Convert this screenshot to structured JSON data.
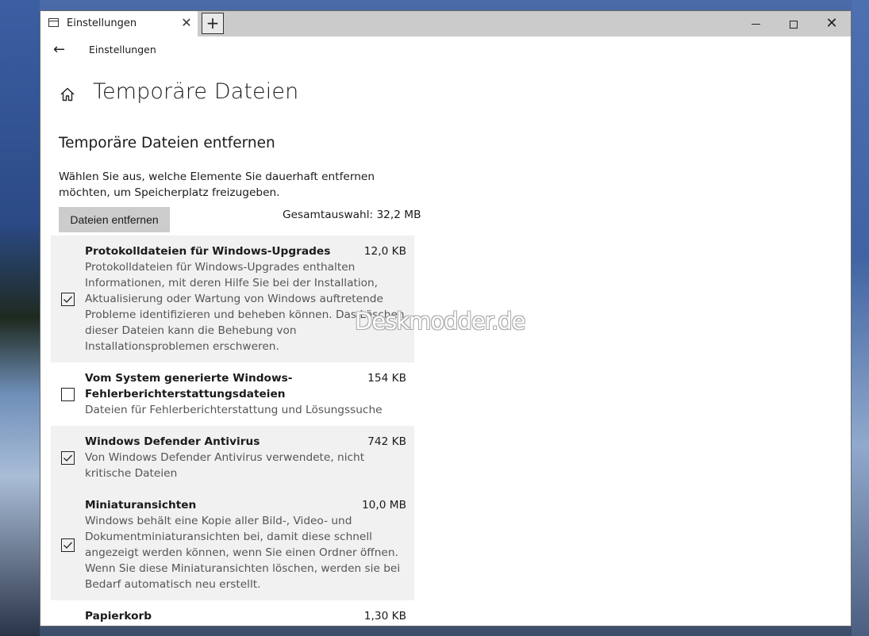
{
  "window": {
    "tab_title": "Einstellungen",
    "tab_close": "✕",
    "new_tab": "+",
    "minimize": "—",
    "close": "✕"
  },
  "nav": {
    "back": "←",
    "breadcrumb": "Einstellungen"
  },
  "page": {
    "title": "Temporäre Dateien",
    "section_title": "Temporäre Dateien entfernen",
    "description": "Wählen Sie aus, welche Elemente Sie dauerhaft entfernen möchten, um Speicherplatz freizugeben.",
    "remove_button": "Dateien entfernen",
    "total_selection": "Gesamtauswahl: 32,2 MB"
  },
  "items": [
    {
      "title": "Protokolldateien für Windows-Upgrades",
      "size": "12,0 KB",
      "checked": true,
      "description": "Protokolldateien für Windows-Upgrades enthalten Informationen, mit deren Hilfe Sie bei der Installation, Aktualisierung oder Wartung von Windows auftretende Probleme identifizieren und beheben können. Das Löschen dieser Dateien kann die Behebung von Installationsproblemen erschweren."
    },
    {
      "title": "Vom System generierte Windows-Fehlerberichterstattungsdateien",
      "size": "154 KB",
      "checked": false,
      "description": "Dateien für Fehlerberichterstattung und Lösungssuche"
    },
    {
      "title": "Windows Defender Antivirus",
      "size": "742 KB",
      "checked": true,
      "description": "Von Windows Defender Antivirus verwendete, nicht kritische Dateien"
    },
    {
      "title": "Miniaturansichten",
      "size": "10,0 MB",
      "checked": true,
      "description": "Windows behält eine Kopie aller Bild-, Video- und Dokumentminiaturansichten bei, damit diese schnell angezeigt werden können, wenn Sie einen Ordner öffnen. Wenn Sie diese Miniaturansichten löschen, werden sie bei Bedarf automatisch neu erstellt."
    },
    {
      "title": "Papierkorb",
      "size": "1,30 KB"
    }
  ],
  "watermark": "Deskmodder.de",
  "colors": {
    "selected_row_bg": "#f1f1f1",
    "button_bg": "#cccccc",
    "titlebar_bg": "#cbcbcb"
  }
}
